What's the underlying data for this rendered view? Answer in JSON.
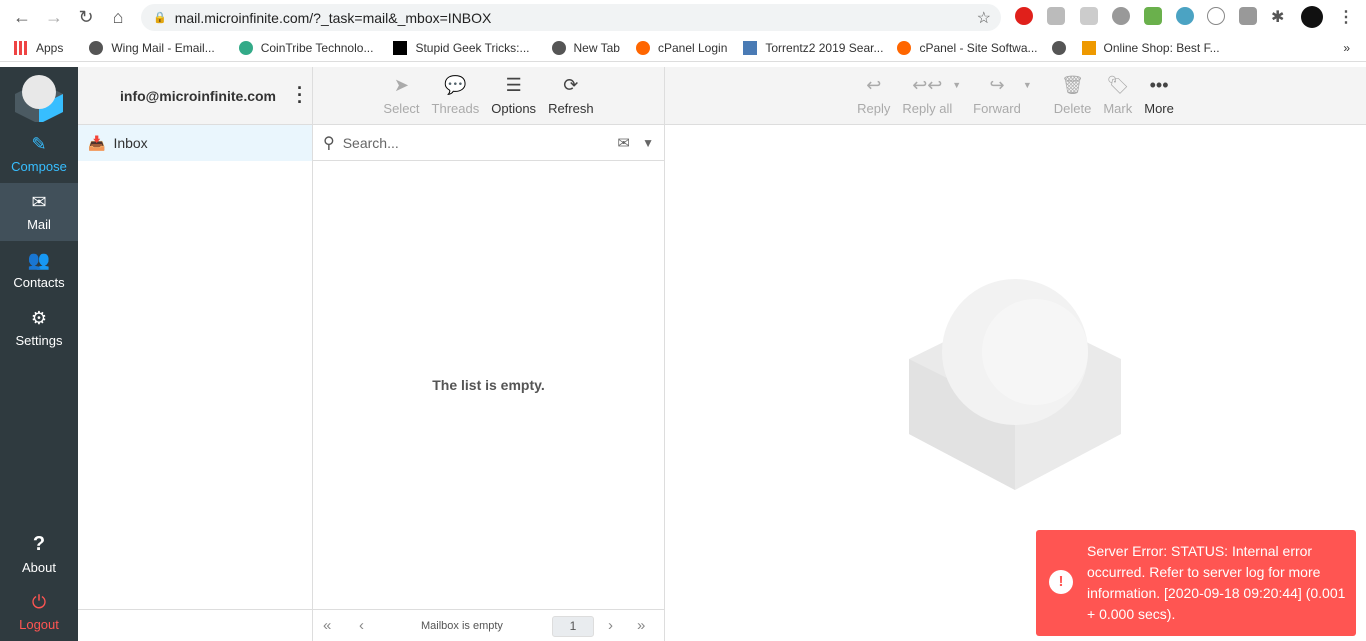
{
  "browser": {
    "url": "mail.microinfinite.com/?_task=mail&_mbox=INBOX",
    "bookmarks": [
      "Apps",
      "Wing Mail - Email...",
      "CoinTribe Technolo...",
      "Stupid Geek Tricks:...",
      "New Tab",
      "cPanel Login",
      "Torrentz2 2019 Sear...",
      "cPanel - Site Softwa...",
      "",
      "Online Shop: Best F..."
    ],
    "more": "»"
  },
  "nav": {
    "compose": "Compose",
    "mail": "Mail",
    "contacts": "Contacts",
    "settings": "Settings",
    "about": "About",
    "logout": "Logout"
  },
  "folders": {
    "account": "info@microinfinite.com",
    "items": [
      {
        "label": "Inbox"
      }
    ]
  },
  "list": {
    "toolbar": {
      "select": "Select",
      "threads": "Threads",
      "options": "Options",
      "refresh": "Refresh"
    },
    "search_placeholder": "Search...",
    "empty": "The list is empty.",
    "footer": {
      "status": "Mailbox is empty",
      "page": "1"
    }
  },
  "message_toolbar": {
    "reply": "Reply",
    "reply_all": "Reply all",
    "forward": "Forward",
    "delete": "Delete",
    "mark": "Mark",
    "more": "More"
  },
  "toast": {
    "text": "Server Error: STATUS: Internal error occurred. Refer to server log for more information. [2020-09-18 09:20:44] (0.001 + 0.000 secs).",
    "icon": "!"
  },
  "colors": {
    "accent": "#37beff",
    "error": "#ff5552",
    "nav_bg": "#2f3a3f"
  }
}
